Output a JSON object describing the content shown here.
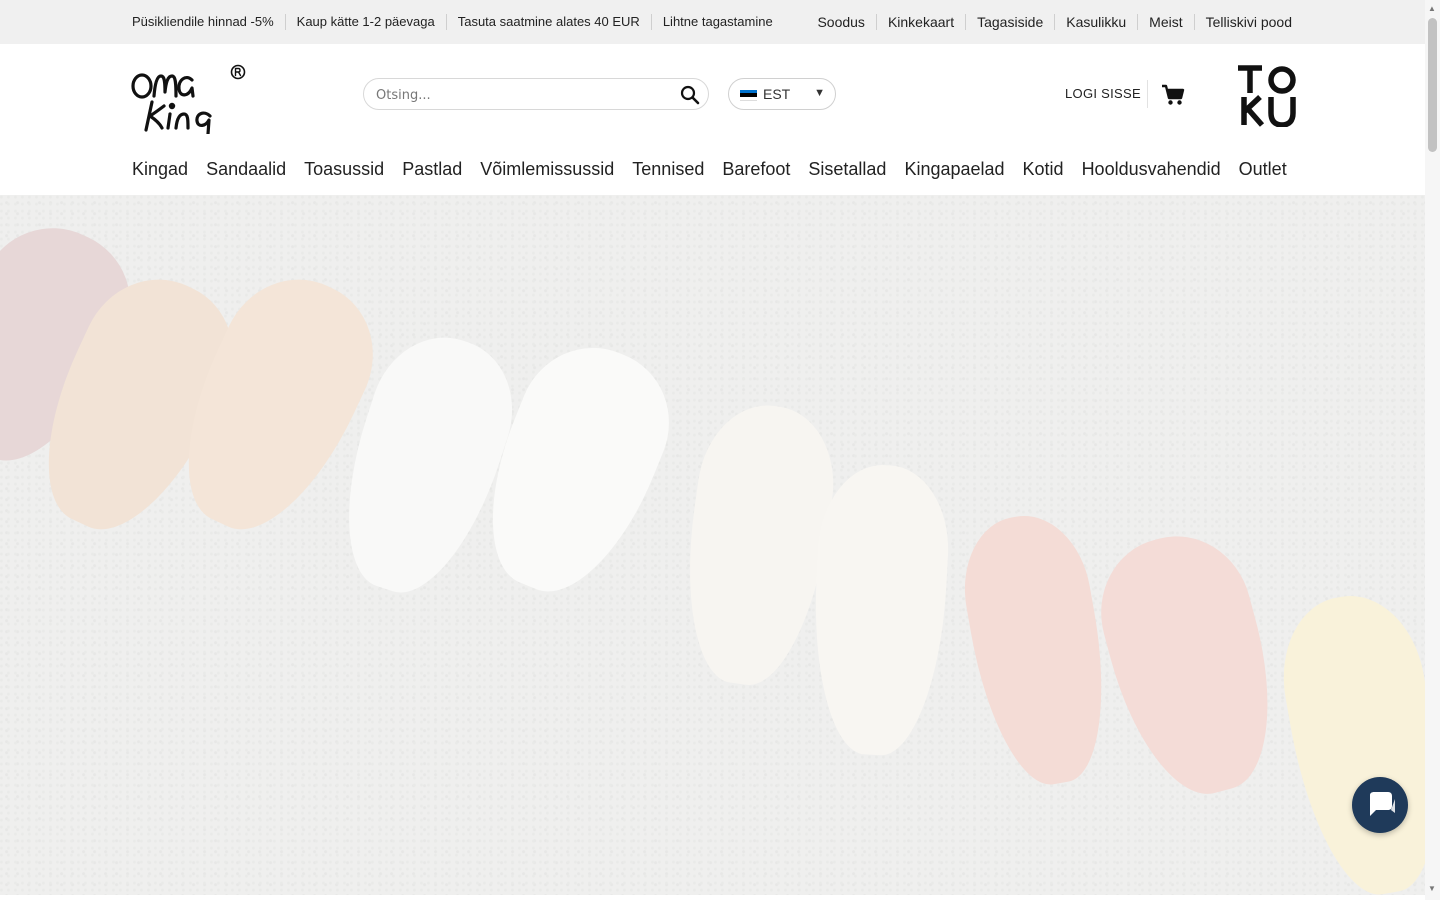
{
  "topbar": {
    "left": [
      "Püsikliendile hinnad -5%",
      "Kaup kätte 1-2 päevaga",
      "Tasuta saatmine alates 40 EUR",
      "Lihtne tagastamine"
    ],
    "right": [
      "Soodus",
      "Kinkekaart",
      "Tagasiside",
      "Kasulikku",
      "Meist",
      "Telliskivi pood"
    ]
  },
  "brand": {
    "logo_text": "omaking",
    "partner_logo": "TOKU"
  },
  "search": {
    "placeholder": "Otsing...",
    "icon": "search-icon"
  },
  "language": {
    "code": "EST",
    "flag_colors": [
      "#0072ce",
      "#000000",
      "#ffffff"
    ]
  },
  "account": {
    "login_label": "LOGI SISSE",
    "cart_icon": "cart-icon"
  },
  "nav": [
    "Kingad",
    "Sandaalid",
    "Toasussid",
    "Pastlad",
    "Võimlemissussid",
    "Tennised",
    "Barefoot",
    "Sisetallad",
    "Kingapaelad",
    "Kotid",
    "Hooldusvahendid",
    "Outlet"
  ],
  "hero": {
    "image": "shoes-on-asphalt"
  },
  "chat": {
    "icon": "chat-icon",
    "color": "#1f3a5a"
  }
}
